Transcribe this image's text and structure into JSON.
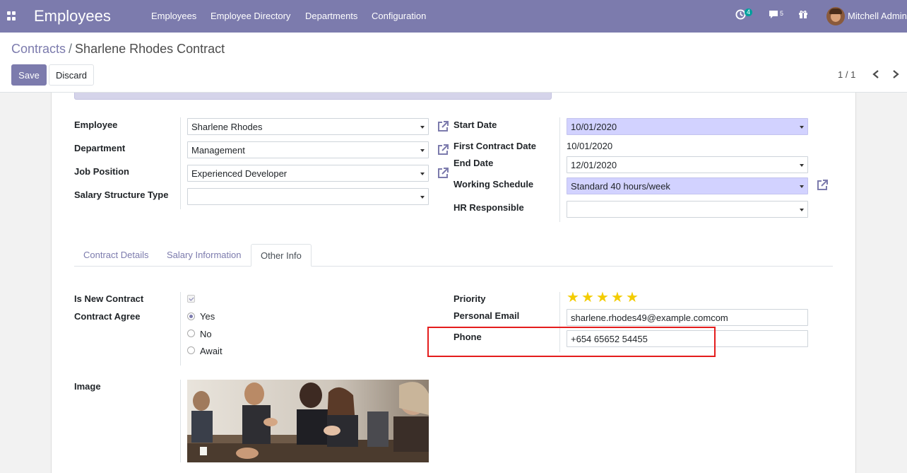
{
  "navbar": {
    "app_title": "Employees",
    "menus": [
      "Employees",
      "Employee Directory",
      "Departments",
      "Configuration"
    ],
    "activity_count": "4",
    "message_count": "5",
    "user_name": "Mitchell Admin"
  },
  "breadcrumb": {
    "parent": "Contracts",
    "separator": "/",
    "current": "Sharlene Rhodes Contract"
  },
  "buttons": {
    "save": "Save",
    "discard": "Discard"
  },
  "pager": {
    "value": "1 / 1"
  },
  "form": {
    "employee_label": "Employee",
    "employee_value": "Sharlene Rhodes",
    "department_label": "Department",
    "department_value": "Management",
    "job_position_label": "Job Position",
    "job_position_value": "Experienced Developer",
    "salary_structure_label": "Salary Structure Type",
    "salary_structure_value": "",
    "start_date_label": "Start Date",
    "start_date_value": "10/01/2020",
    "first_contract_label": "First Contract Date",
    "first_contract_value": "10/01/2020",
    "end_date_label": "End Date",
    "end_date_value": "12/01/2020",
    "working_schedule_label": "Working Schedule",
    "working_schedule_value": "Standard 40 hours/week",
    "hr_responsible_label": "HR Responsible",
    "hr_responsible_value": ""
  },
  "tabs": [
    "Contract Details",
    "Salary Information",
    "Other Info"
  ],
  "other_info": {
    "is_new_contract_label": "Is New Contract",
    "is_new_contract_checked": true,
    "contract_agree_label": "Contract Agree",
    "contract_agree_options": [
      "Yes",
      "No",
      "Await"
    ],
    "contract_agree_selected": "Yes",
    "priority_label": "Priority",
    "priority_stars": 5,
    "priority_max": 5,
    "personal_email_label": "Personal Email",
    "personal_email_value": "sharlene.rhodes49@example.comcom",
    "phone_label": "Phone",
    "phone_value": "+654 65652 54455",
    "image_label": "Image"
  },
  "colors": {
    "navbar": "#7c7bad",
    "required_field": "#d2d2ff",
    "star": "#f3cc00",
    "highlight": "#e41d1d"
  },
  "icons": {
    "apps": "apps-grid-icon",
    "activity": "clock-icon",
    "messages": "chat-icon",
    "gift": "gift-icon",
    "external": "external-link-icon",
    "prev": "chevron-left-icon",
    "next": "chevron-right-icon",
    "star": "star-icon"
  }
}
